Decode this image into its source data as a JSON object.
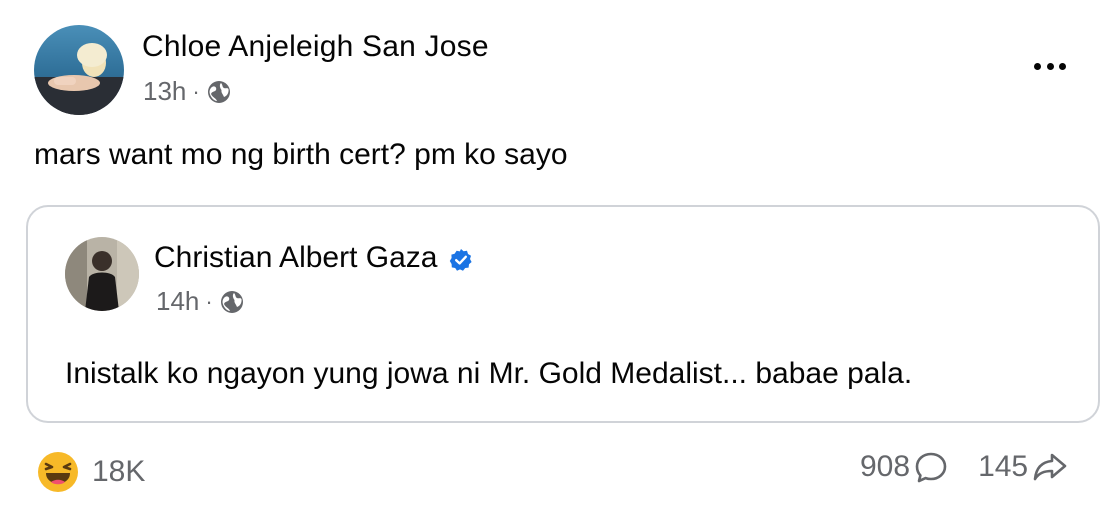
{
  "post": {
    "author": "Chloe Anjeleigh San Jose",
    "time": "13h",
    "separator": "·",
    "privacy_icon": "globe-icon",
    "text": "mars want mo ng birth cert? pm ko sayo",
    "more_icon": "more-options-icon"
  },
  "shared_post": {
    "author": "Christian Albert Gaza",
    "verified_icon": "verified-badge-icon",
    "time": "14h",
    "separator": "·",
    "privacy_icon": "globe-icon",
    "text": "Inistalk ko ngayon yung jowa ni Mr. Gold Medalist... babae pala."
  },
  "footer": {
    "reaction_icon": "haha-reaction-icon",
    "reaction_count": "18K",
    "comments_count": "908",
    "comments_icon": "comment-icon",
    "shares_count": "145",
    "shares_icon": "share-icon"
  },
  "colors": {
    "text_primary": "#050505",
    "text_secondary": "#65676b",
    "verified_blue": "#1b74e4",
    "haha_yellow": "#f7b928",
    "card_border": "#d0d3d8"
  }
}
